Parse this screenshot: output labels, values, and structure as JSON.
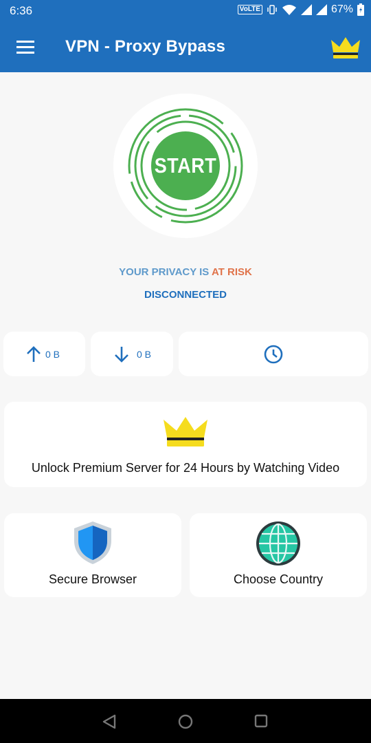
{
  "status_bar": {
    "time": "6:36",
    "volte": "VoLTE",
    "battery_percent": "67%"
  },
  "app_bar": {
    "title": "VPN - Proxy Bypass"
  },
  "connect_button": {
    "label": "START"
  },
  "privacy": {
    "prefix": "YOUR PRIVACY IS ",
    "risk": "AT RISK"
  },
  "connection_status": "DISCONNECTED",
  "stats": {
    "upload": "0 B",
    "download": "0 B"
  },
  "premium_card": {
    "label": "Unlock Premium Server for 24 Hours by Watching Video"
  },
  "features": {
    "secure_browser": "Secure Browser",
    "choose_country": "Choose Country"
  },
  "colors": {
    "primary": "#1f6fbd",
    "start_green": "#4caf50",
    "risk": "#e0734a",
    "crown_yellow": "#f5dc1e"
  }
}
